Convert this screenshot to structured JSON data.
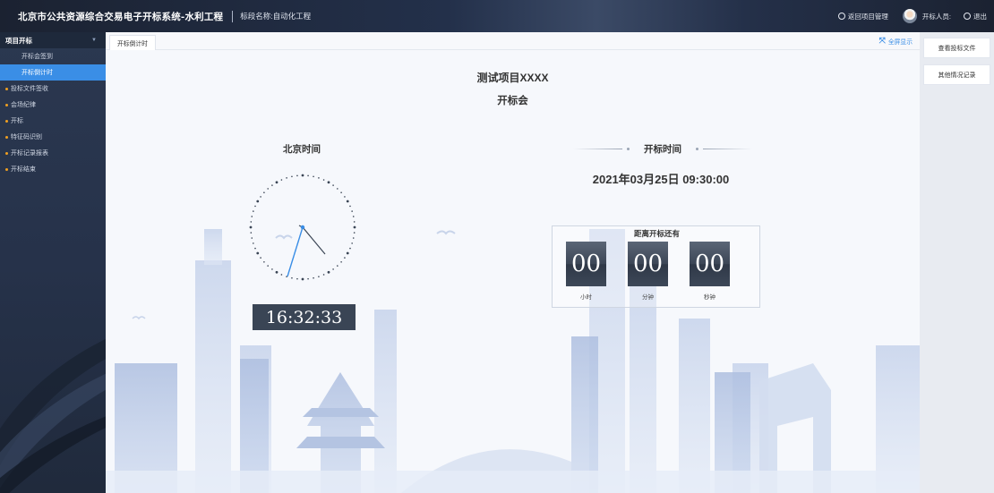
{
  "header": {
    "title": "北京市公共资源综合交易电子开标系统-水利工程",
    "section": "标段名称:自动化工程",
    "return_label": "返回项目管理",
    "opener_label": "开标人员:",
    "logout_label": "退出"
  },
  "sidebar": {
    "group_label": "项目开标",
    "items": [
      {
        "label": "开标会签到",
        "active": false,
        "bullet": false
      },
      {
        "label": "开标倒计时",
        "active": true,
        "bullet": false
      },
      {
        "label": "投标文件签收",
        "active": false,
        "bullet": true
      },
      {
        "label": "会场纪律",
        "active": false,
        "bullet": true
      },
      {
        "label": "开标",
        "active": false,
        "bullet": true
      },
      {
        "label": "特征码识别",
        "active": false,
        "bullet": true
      },
      {
        "label": "开标记录报表",
        "active": false,
        "bullet": true
      },
      {
        "label": "开标结束",
        "active": false,
        "bullet": true
      }
    ]
  },
  "tabs": [
    {
      "label": "开标倒计时"
    }
  ],
  "fullscreen_label": "全屏显示",
  "main": {
    "project_name": "测试项目XXXX",
    "meeting_label": "开标会",
    "beijing_time_label": "北京时间",
    "digital_time": "16:32:33",
    "open_time_label": "开标时间",
    "open_datetime": "2021年03月25日 09:30:00",
    "countdown_title": "距离开标还有",
    "countdown": {
      "hours": "00",
      "minutes": "00",
      "seconds": "00",
      "hours_label": "小时",
      "minutes_label": "分钟",
      "seconds_label": "秒钟"
    }
  },
  "right_panel": {
    "view_bid_label": "查看投标文件",
    "other_record_label": "其他情况记录"
  },
  "colors": {
    "accent": "#3a8ee6",
    "header_bg": "#1b2231",
    "sidebar_bg": "#26324a",
    "bullet": "#f0a020",
    "digit_bg": "#3a4555"
  },
  "icons": {
    "return": "return-icon",
    "avatar": "avatar",
    "logout": "power-icon",
    "fullscreen": "expand-icon"
  }
}
